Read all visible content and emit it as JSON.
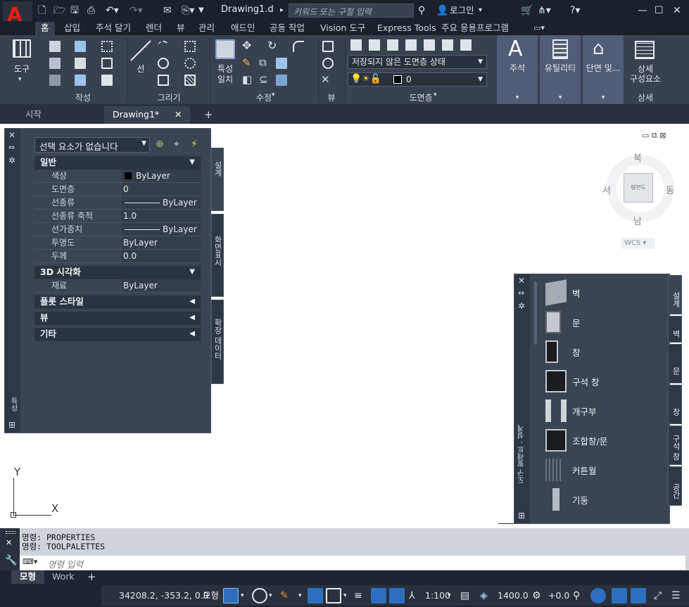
{
  "titlebar": {
    "app_logo": "A",
    "app_logo_sub": "A",
    "doc_title": "Drawing1.d",
    "search_placeholder": "키워드 또는 구절 입력",
    "login": "로그인"
  },
  "ribbon_tabs": [
    "홈",
    "삽입",
    "주석 달기",
    "렌더",
    "뷰",
    "관리",
    "애드인",
    "공동 작업",
    "Vision 도구",
    "Express Tools",
    "주요 응용프로그램"
  ],
  "ribbon": {
    "panels": {
      "create": "작성",
      "draw": "그리기",
      "modify": "수정",
      "view": "뷰",
      "layers": "도면층",
      "detail": "상세"
    },
    "tool_label": "도구",
    "line_label": "선",
    "match_label1": "특성",
    "match_label2": "일치",
    "layer_state": "저장되지 않은 도면층 상태",
    "layer_current": "0",
    "annotate_label": "주석",
    "utility_label": "유틸리티",
    "section_label": "단면 및...",
    "detail_label1": "상세",
    "detail_label2": "구성요소"
  },
  "file_tabs": {
    "start": "시작",
    "drawing": "Drawing1*"
  },
  "properties": {
    "selection": "선택 요소가 없습니다",
    "categories": {
      "general": "일반",
      "visual3d": "3D 시각화",
      "plot": "플롯 스타일",
      "view": "뷰",
      "misc": "기타"
    },
    "rows": [
      {
        "k": "색상",
        "v": "ByLayer"
      },
      {
        "k": "도면층",
        "v": "0"
      },
      {
        "k": "선종류",
        "v": "ByLayer"
      },
      {
        "k": "선종류 축척",
        "v": "1.0"
      },
      {
        "k": "선가중치",
        "v": "ByLayer"
      },
      {
        "k": "투명도",
        "v": "ByLayer"
      },
      {
        "k": "두께",
        "v": "0.0"
      }
    ],
    "material_k": "재료",
    "material_v": "ByLayer",
    "side_tabs": [
      "설계",
      "화면표시",
      "확장 데이터"
    ],
    "strip_label": "특성"
  },
  "viewcube": {
    "north": "북",
    "south": "남",
    "west": "서",
    "east": "동",
    "face": "평면도",
    "wcs": "WCS"
  },
  "toolpalette": {
    "items": [
      "벽",
      "문",
      "창",
      "구석 창",
      "개구부",
      "조합창/문",
      "커튼월",
      "기둥"
    ],
    "tabs": [
      "설계",
      "벽",
      "문",
      "창",
      "구석 창",
      "공간"
    ],
    "strip_label": "도구 팔레트 - 설계"
  },
  "ucs": {
    "x": "X",
    "y": "Y"
  },
  "command": {
    "history": [
      "명령: PROPERTIES",
      "명령: TOOLPALETTES"
    ],
    "placeholder": "명령 입력"
  },
  "layout_tabs": [
    "모형",
    "Work"
  ],
  "status": {
    "coords": "34208.2, -353.2, 0.0",
    "model": "모형",
    "scale": "1:100",
    "elevation": "1400.0",
    "offset": "+0.0"
  }
}
